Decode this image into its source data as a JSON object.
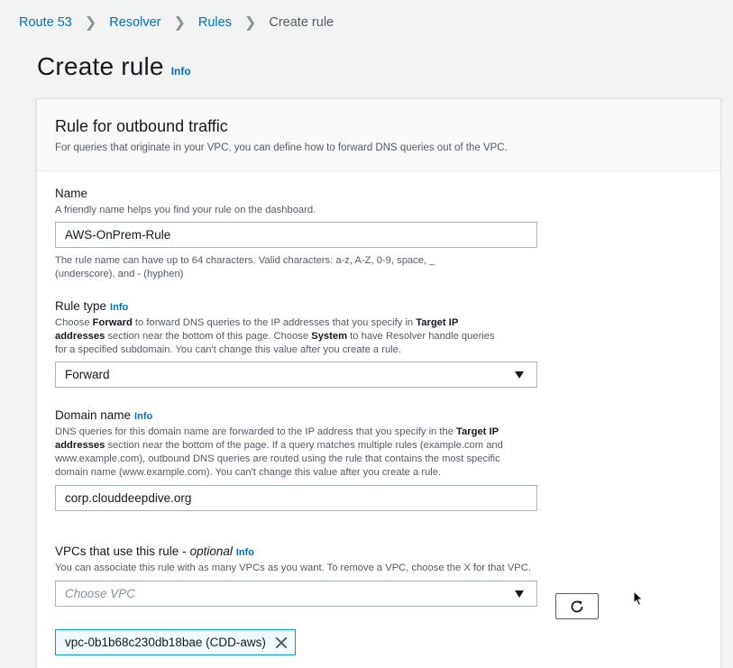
{
  "breadcrumb": {
    "items": [
      "Route 53",
      "Resolver",
      "Rules"
    ],
    "current": "Create rule"
  },
  "page": {
    "title": "Create rule",
    "info": "Info"
  },
  "panel": {
    "title": "Rule for outbound traffic",
    "description": "For queries that originate in your VPC, you can define how to forward DNS queries out of the VPC."
  },
  "name_field": {
    "label": "Name",
    "description": "A friendly name helps you find your rule on the dashboard.",
    "value": "AWS-OnPrem-Rule",
    "constraint": "The rule name can have up to 64 characters. Valid characters: a-z, A-Z, 0-9, space, _ (underscore), and - (hyphen)"
  },
  "rule_type": {
    "label": "Rule type",
    "info": "Info",
    "desc_1": "Choose ",
    "desc_b1": "Forward",
    "desc_2": " to forward DNS queries to the IP addresses that you specify in ",
    "desc_b2": "Target IP addresses",
    "desc_3": " section near the bottom of this page. Choose ",
    "desc_b3": "System",
    "desc_4": " to have Resolver handle queries for a specified subdomain. You can't change this value after you create a rule.",
    "selected": "Forward"
  },
  "domain_name": {
    "label": "Domain name",
    "info": "Info",
    "desc_1": "DNS queries for this domain name are forwarded to the IP address that you specify in the ",
    "desc_b1": "Target IP addresses",
    "desc_2": " section near the bottom of the page. If a query matches multiple rules (example.com and www.example.com), outbound DNS queries are routed using the rule that contains the most specific domain name (www.example.com). You can't change this value after you create a rule.",
    "value": "corp.clouddeepdive.org"
  },
  "vpcs": {
    "label": "VPCs that use this rule - ",
    "optional": "optional",
    "info": "Info",
    "description": "You can associate this rule with as many VPCs as you want. To remove a VPC, choose the X for that VPC.",
    "placeholder": "Choose VPC",
    "token": "vpc-0b1b68c230db18bae (CDD-aws)"
  },
  "icons": {
    "chevron": "chevron-right-icon",
    "caret": "caret-down-icon",
    "refresh": "refresh-icon",
    "close": "close-icon",
    "cursor": "mouse-pointer-icon"
  },
  "colors": {
    "link": "#0073bb",
    "token_border": "#00a1c9",
    "token_bg": "#f1faff"
  }
}
